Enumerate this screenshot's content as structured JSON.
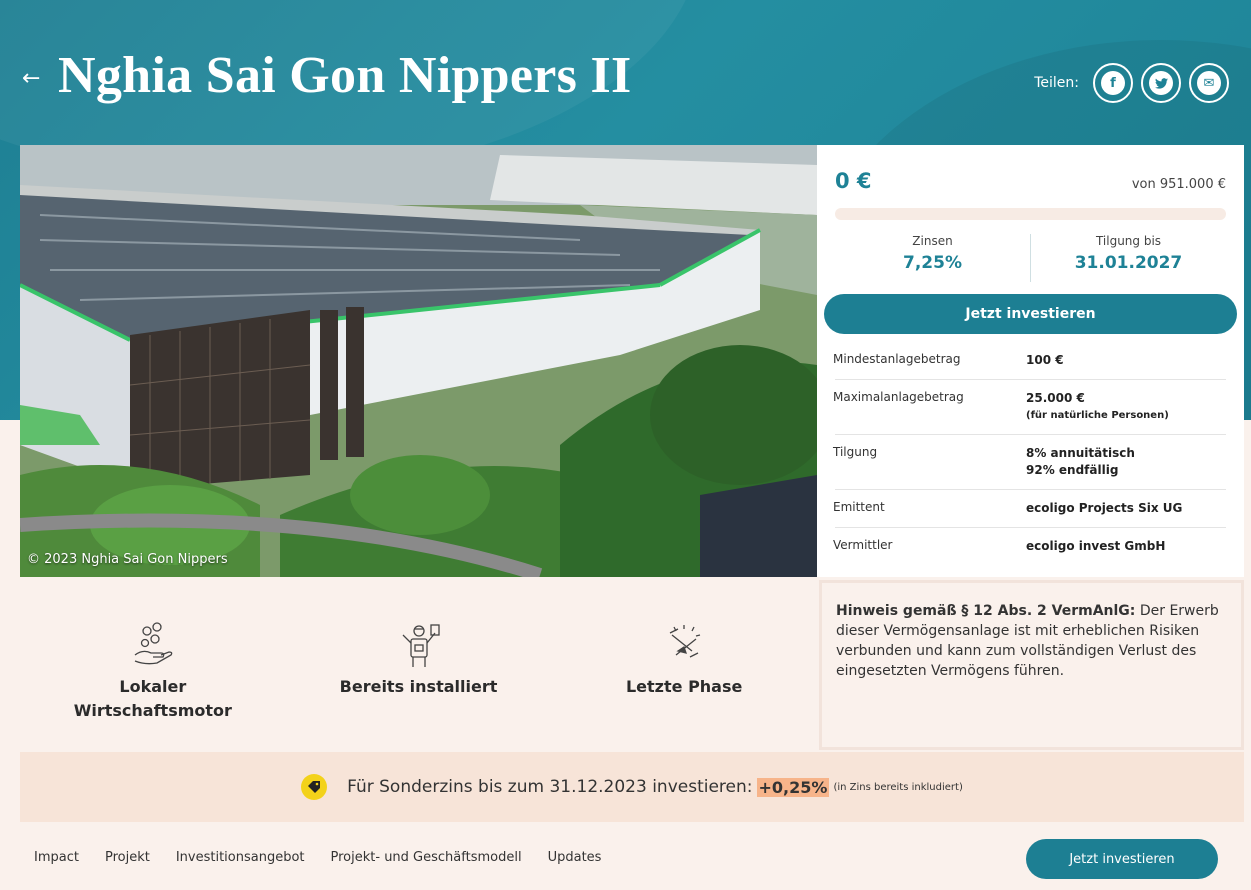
{
  "header": {
    "back_label": "←",
    "title": "Nghia Sai Gon Nippers II",
    "share_label": "Teilen:",
    "share_buttons": [
      {
        "name": "facebook-icon",
        "glyph": "f"
      },
      {
        "name": "twitter-icon",
        "glyph": "t"
      },
      {
        "name": "mail-icon",
        "glyph": "✉"
      }
    ]
  },
  "photo": {
    "credit": "© 2023 Nghia Sai Gon Nippers"
  },
  "investment": {
    "amount": "0 €",
    "target": "von 951.000 €",
    "progress_fraction": 0,
    "interest_label": "Zinsen",
    "interest_value": "7,25%",
    "repayment_label": "Tilgung bis",
    "repayment_value": "31.01.2027",
    "invest_button": "Jetzt investieren",
    "facts": [
      {
        "label": "Mindestanlagebetrag",
        "value": "100 €",
        "note": ""
      },
      {
        "label": "Maximalanlagebetrag",
        "value": "25.000 €",
        "note": "(für natürliche Personen)"
      },
      {
        "label": "Tilgung",
        "value": "8% annuitätisch",
        "note": "92% endfällig"
      },
      {
        "label": "Emittent",
        "value": "ecoligo Projects Six UG",
        "note": ""
      },
      {
        "label": "Vermittler",
        "value": "ecoligo invest GmbH",
        "note": ""
      }
    ]
  },
  "features": [
    {
      "icon": "hand-coins-icon",
      "label": "Lokaler Wirtschaftsmotor"
    },
    {
      "icon": "solar-installer-icon",
      "label": "Bereits installiert"
    },
    {
      "icon": "hourglass-icon",
      "label": "Letzte Phase"
    }
  ],
  "notice": {
    "bold": "Hinweis gemäß § 12 Abs. 2 VermAnlG:",
    "text": " Der Erwerb dieser Vermögensanlage ist mit erheblichen Risiken verbunden und kann zum vollständigen Verlust des eingesetzten Vermögens führen."
  },
  "promo": {
    "text": "Für Sonderzins bis zum 31.12.2023 investieren:",
    "highlight": "+0,25%",
    "note": "(in Zins bereits inkludiert)"
  },
  "bottom_nav": {
    "links": [
      "Impact",
      "Projekt",
      "Investitionsangebot",
      "Projekt- und Geschäftsmodell",
      "Updates"
    ],
    "invest_button": "Jetzt investieren"
  },
  "colors": {
    "accent": "#1d7f93",
    "highlight": "#f7b48a",
    "tag": "#f3d21a"
  }
}
